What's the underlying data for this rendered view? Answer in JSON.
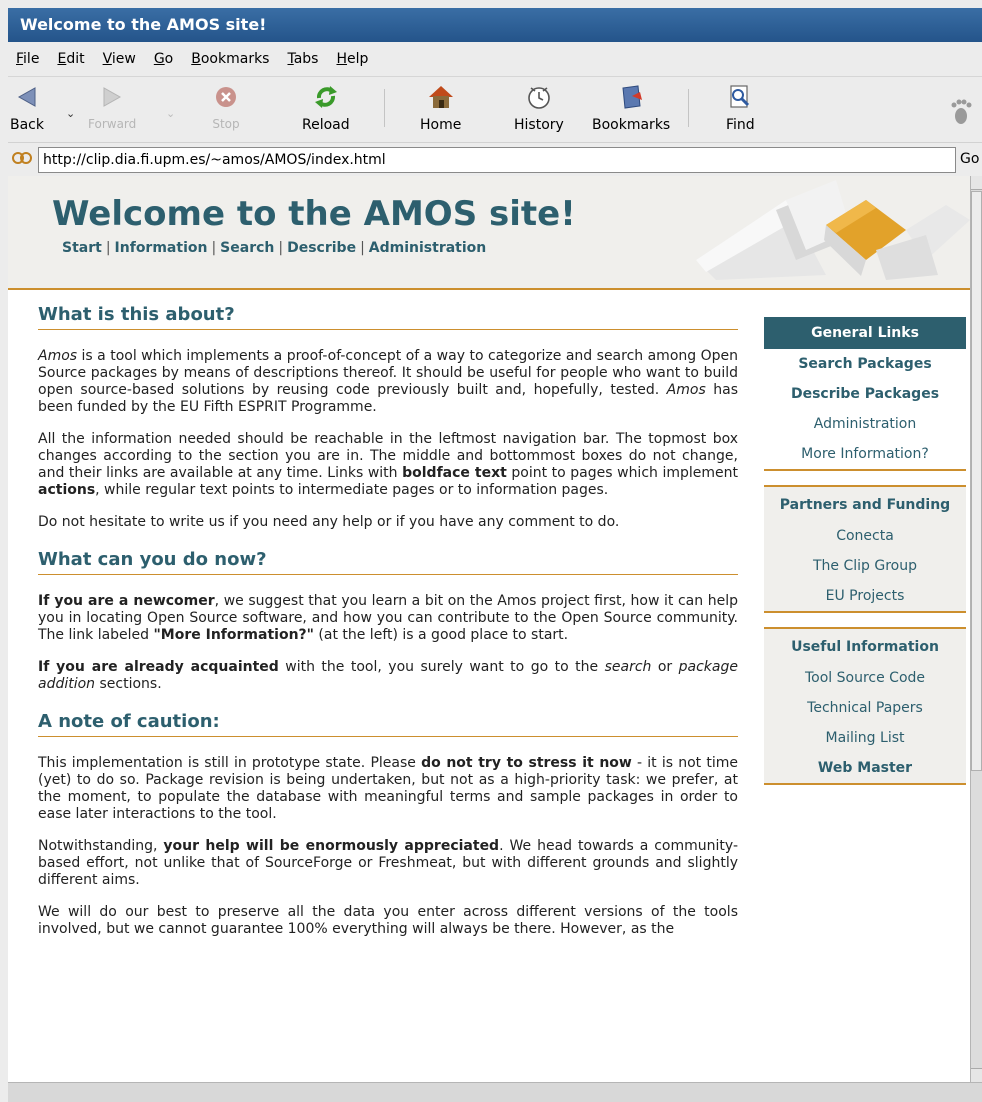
{
  "window": {
    "title": "Welcome to the AMOS site!"
  },
  "menu": [
    {
      "pre": "",
      "u": "F",
      "post": "ile"
    },
    {
      "pre": "",
      "u": "E",
      "post": "dit"
    },
    {
      "pre": "",
      "u": "V",
      "post": "iew"
    },
    {
      "pre": "",
      "u": "G",
      "post": "o"
    },
    {
      "pre": "",
      "u": "B",
      "post": "ookmarks"
    },
    {
      "pre": "",
      "u": "T",
      "post": "abs"
    },
    {
      "pre": "",
      "u": "H",
      "post": "elp"
    }
  ],
  "toolbar": {
    "back": "Back",
    "forward": "Forward",
    "stop": "Stop",
    "reload": "Reload",
    "home": "Home",
    "history": "History",
    "bookmarks": "Bookmarks",
    "find": "Find"
  },
  "address": {
    "url": "http://clip.dia.fi.upm.es/~amos/AMOS/index.html",
    "go": "Go"
  },
  "header": {
    "title": "Welcome to the AMOS site!",
    "nav": [
      "Start",
      "Information",
      "Search",
      "Describe",
      "Administration"
    ]
  },
  "sections": {
    "about_title": "What is this about?",
    "about_p1": {
      "a": "Amos",
      "b": " is a tool which implements a proof-of-concept of a way to categorize and search among Open Source packages by means of descriptions thereof. It should be useful for people who want to build open source-based solutions by reusing code previously built and, hopefully, tested. ",
      "c": "Amos",
      "d": " has been funded by the EU Fifth ESPRIT Programme."
    },
    "about_p2": {
      "a": "All the information needed should be reachable in the leftmost navigation bar. The topmost box changes according to the section you are in. The middle and bottommost boxes do not change, and their links are available at any time. Links with ",
      "b": "boldface text",
      "c": " point to pages which implement ",
      "d": "actions",
      "e": ", while regular text points to intermediate pages or to information pages."
    },
    "about_p3": "Do not hesitate to write us if you need any help or if you have any comment to do.",
    "now_title": "What can you do now?",
    "now_p1": {
      "a": "If you are a newcomer",
      "b": ", we suggest that you learn a bit on the Amos project first, how it can help you in locating Open Source software, and how you can contribute to the Open Source community. The link labeled ",
      "c": "\"More Information?\"",
      "d": " (at the left) is a good place to start."
    },
    "now_p2": {
      "a": "If you are already acquainted",
      "b": " with the tool, you surely want to go to the ",
      "c": "search",
      "d": " or ",
      "e": "package addition",
      "f": " sections."
    },
    "caution_title": "A note of caution:",
    "caution_p1": {
      "a": "This implementation is still in prototype state. Please ",
      "b": "do not try to stress it now",
      "c": " - it is not time (yet) to do so. Package revision is being undertaken, but not as a high-priority task: we prefer, at the moment, to populate the database with meaningful terms and sample packages in order to ease later interactions to the tool."
    },
    "caution_p2": {
      "a": "Notwithstanding, ",
      "b": "your help will be enormously appreciated",
      "c": ". We head towards a community-based effort, not unlike that of SourceForge or Freshmeat, but with different grounds and slightly different aims."
    },
    "caution_p3": "We will do our best to preserve all the data you enter across different versions of the tools involved, but we cannot guarantee 100% everything will always be there. However, as the"
  },
  "sidebar": {
    "general": {
      "title": "General Links",
      "items": [
        "Search Packages",
        "Describe Packages",
        "Administration",
        "More Information?"
      ]
    },
    "partners": {
      "title": "Partners and Funding",
      "items": [
        "Conecta",
        "The Clip Group",
        "EU Projects"
      ]
    },
    "useful": {
      "title": "Useful Information",
      "items": [
        "Tool Source Code",
        "Technical Papers",
        "Mailing List",
        "Web Master"
      ]
    }
  }
}
